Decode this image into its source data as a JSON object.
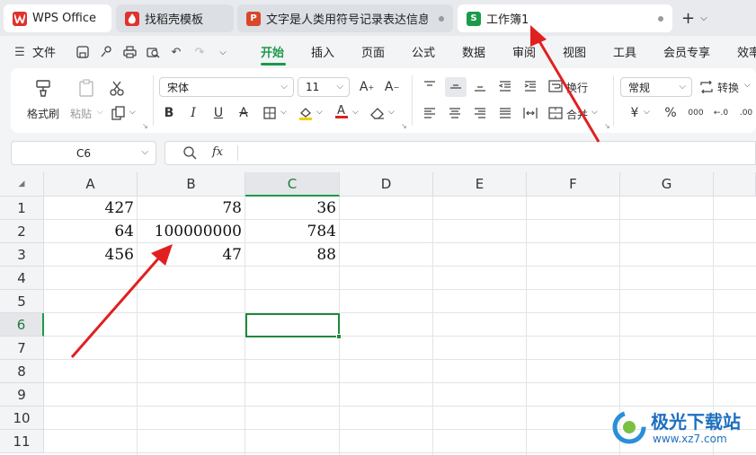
{
  "tabs": [
    {
      "label": "WPS Office",
      "icon": "wps-logo-icon"
    },
    {
      "label": "找稻壳模板",
      "icon": "docer-icon"
    },
    {
      "label": "文字是人类用符号记录表达信息以",
      "icon": "presentation-icon"
    },
    {
      "label": "工作簿1",
      "icon": "spreadsheet-icon"
    }
  ],
  "tab_icon_letters": {
    "doc": "P",
    "book": "S"
  },
  "new_tab": "+",
  "menu": {
    "file": "文件",
    "items": [
      "开始",
      "插入",
      "页面",
      "公式",
      "数据",
      "审阅",
      "视图",
      "工具",
      "会员专享",
      "效率"
    ],
    "active": "开始"
  },
  "ribbon": {
    "format_painter": "格式刷",
    "paste": "粘贴",
    "font_name": "宋体",
    "font_size": "11",
    "wrap_text": "换行",
    "merge": "合并",
    "number_format": "常规",
    "convert": "转换"
  },
  "formula_bar": {
    "name_box": "C6",
    "fx": "fx"
  },
  "sheet": {
    "columns": [
      "A",
      "B",
      "C",
      "D",
      "E",
      "F",
      "G"
    ],
    "rows": [
      "1",
      "2",
      "3",
      "4",
      "5",
      "6",
      "7",
      "8",
      "9",
      "10",
      "11"
    ],
    "cells": {
      "A1": "427",
      "B1": "78",
      "C1": "36",
      "A2": "64",
      "B2": "100000000",
      "C2": "784",
      "A3": "456",
      "B3": "47",
      "C3": "88"
    },
    "selected_column": "C",
    "selected_row": "6"
  },
  "watermark": {
    "name": "极光下载站",
    "url": "www.xz7.com"
  },
  "colors": {
    "accent": "#1c9a4a",
    "arrow": "#e02020",
    "selection": "#1c8a3a"
  }
}
